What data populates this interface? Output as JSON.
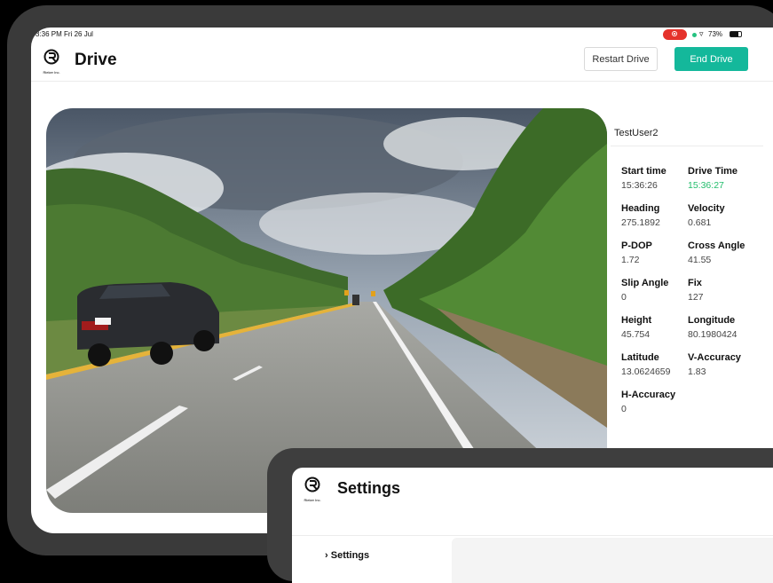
{
  "status_bar": {
    "time": "3:36 PM  Fri 26 Jul",
    "battery": "73%"
  },
  "header": {
    "logo_text": "Rieker Inc.",
    "title": "Drive",
    "restart_button": "Restart Drive",
    "end_button": "End Drive"
  },
  "info": {
    "username": "TestUser2",
    "fields": [
      {
        "label": "Start time",
        "value": "15:36:26"
      },
      {
        "label": "Drive Time",
        "value": "15:36:27"
      },
      {
        "label": "Heading",
        "value": "275.1892"
      },
      {
        "label": "Velocity",
        "value": "0.681"
      },
      {
        "label": "P-DOP",
        "value": "1.72"
      },
      {
        "label": "Cross Angle",
        "value": "41.55"
      },
      {
        "label": "Slip Angle",
        "value": "0"
      },
      {
        "label": "Fix",
        "value": "127"
      },
      {
        "label": "Height",
        "value": "45.754"
      },
      {
        "label": "Longitude",
        "value": "80.1980424"
      },
      {
        "label": "Latitude",
        "value": "13.0624659"
      },
      {
        "label": "V-Accuracy",
        "value": "1.83"
      },
      {
        "label": "H-Accuracy",
        "value": "0"
      }
    ]
  },
  "settings": {
    "logo_text": "Rieker Inc.",
    "title": "Settings",
    "nav_item": "Settings"
  },
  "colors": {
    "accent": "#14b89b",
    "drive_time": "#21bd6b",
    "record": "#e5322b"
  },
  "icons": [
    "screen-record-icon",
    "wifi-icon",
    "battery-icon",
    "rieker-logo-icon",
    "chevron-icon"
  ]
}
